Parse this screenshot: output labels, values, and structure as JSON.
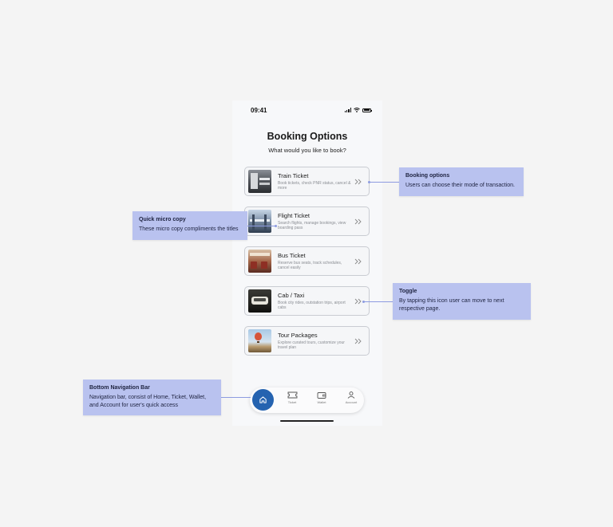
{
  "status_bar": {
    "time": "09:41"
  },
  "header": {
    "title": "Booking Options",
    "subtitle": "What would you like to book?"
  },
  "cards": [
    {
      "title": "Train Ticket",
      "description": "Book tickets, check PNR status, cancel & more",
      "icon": "train-photo"
    },
    {
      "title": "Flight Ticket",
      "description": "Search flights, manage bookings, view boarding pass",
      "icon": "flight-photo"
    },
    {
      "title": "Bus Ticket",
      "description": "Reserve bus seats, track schedules, cancel easily",
      "icon": "bus-photo"
    },
    {
      "title": "Cab / Taxi",
      "description": "Book city rides, outstation trips, airport cabs",
      "icon": "cab-photo"
    },
    {
      "title": "Tour Packages",
      "description": "Explore curated tours, customize your travel plan",
      "icon": "tour-photo"
    }
  ],
  "bottom_nav": {
    "items": [
      {
        "label": "Home",
        "icon": "home-icon",
        "active": true
      },
      {
        "label": "Ticket",
        "icon": "ticket-icon"
      },
      {
        "label": "Wallet",
        "icon": "wallet-icon"
      },
      {
        "label": "Account",
        "icon": "account-icon"
      }
    ],
    "active_color": "#2563b0"
  },
  "annotations": {
    "booking_options": {
      "title": "Booking options",
      "body": "Users can choose their mode of transaction."
    },
    "quick_micro_copy": {
      "title": "Quick micro copy",
      "body": "These micro copy compliments the titles"
    },
    "toggle": {
      "title": "Toggle",
      "body": "By tapping this icon user can move to next respective page."
    },
    "bottom_nav_bar": {
      "title": "Bottom Navigation Bar",
      "body": "Navigation bar, consist of Home, Ticket, Wallet, and Account for user's quick access"
    }
  },
  "colors": {
    "callout_bg": "#b9c2ef",
    "connector": "#8d9be0",
    "page_bg": "#f4f4f4"
  }
}
